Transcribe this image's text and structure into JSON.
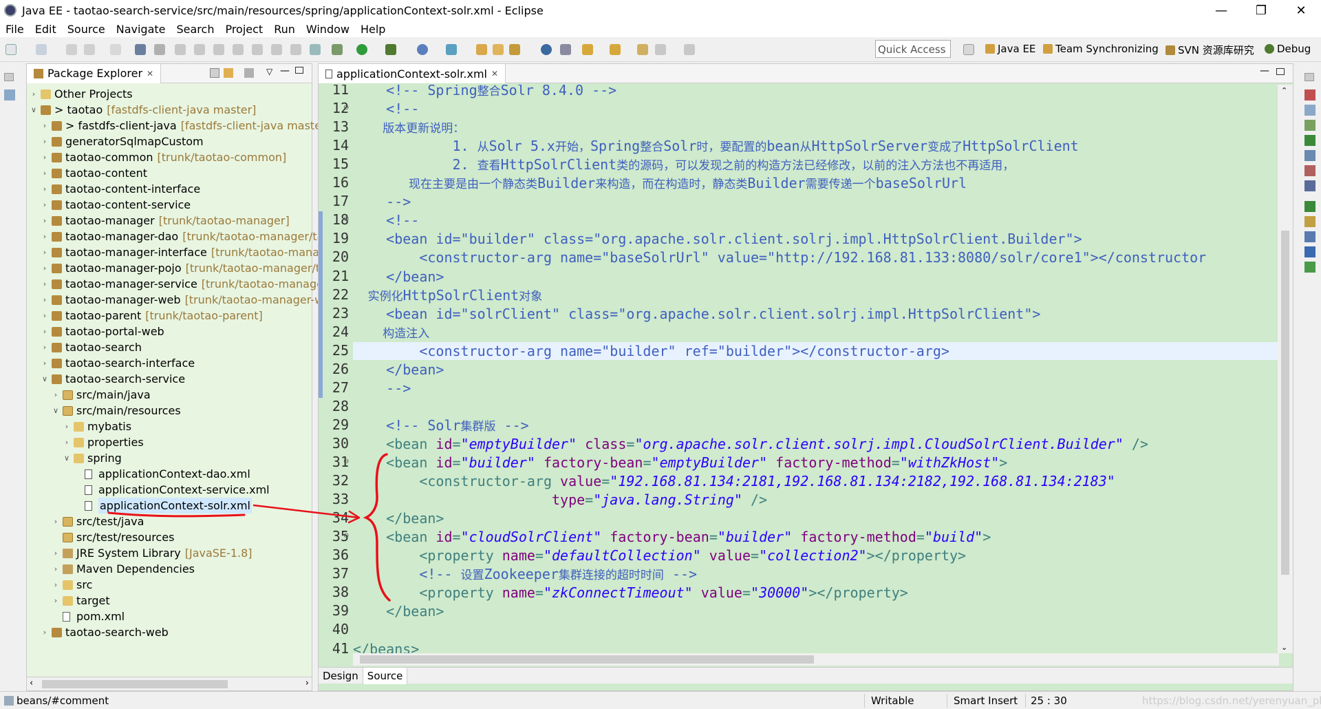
{
  "window": {
    "title": "Java EE - taotao-search-service/src/main/resources/spring/applicationContext-solr.xml - Eclipse"
  },
  "menu": [
    "File",
    "Edit",
    "Source",
    "Navigate",
    "Search",
    "Project",
    "Run",
    "Window",
    "Help"
  ],
  "toolbar": {
    "quick_access": "Quick Access",
    "perspectives": [
      "Java EE",
      "Team Synchronizing",
      "SVN 资源库研究",
      "Debug"
    ]
  },
  "package_explorer": {
    "title": "Package Explorer",
    "items": [
      {
        "label": "Other Projects",
        "decoration": "",
        "depth": 0,
        "expand": "closed",
        "icon": "folder"
      },
      {
        "label": "> taotao",
        "decoration": "[fastdfs-client-java master]",
        "depth": 0,
        "expand": "open",
        "icon": "project"
      },
      {
        "label": "> fastdfs-client-java",
        "decoration": "[fastdfs-client-java master]",
        "depth": 1,
        "expand": "closed",
        "icon": "project"
      },
      {
        "label": "generatorSqlmapCustom",
        "decoration": "",
        "depth": 1,
        "expand": "closed",
        "icon": "project"
      },
      {
        "label": "taotao-common",
        "decoration": "[trunk/taotao-common]",
        "depth": 1,
        "expand": "closed",
        "icon": "project"
      },
      {
        "label": "taotao-content",
        "decoration": "",
        "depth": 1,
        "expand": "closed",
        "icon": "project"
      },
      {
        "label": "taotao-content-interface",
        "decoration": "",
        "depth": 1,
        "expand": "closed",
        "icon": "project"
      },
      {
        "label": "taotao-content-service",
        "decoration": "",
        "depth": 1,
        "expand": "closed",
        "icon": "project"
      },
      {
        "label": "taotao-manager",
        "decoration": "[trunk/taotao-manager]",
        "depth": 1,
        "expand": "closed",
        "icon": "project"
      },
      {
        "label": "taotao-manager-dao",
        "decoration": "[trunk/taotao-manager/tao",
        "depth": 1,
        "expand": "closed",
        "icon": "project"
      },
      {
        "label": "taotao-manager-interface",
        "decoration": "[trunk/taotao-manage",
        "depth": 1,
        "expand": "closed",
        "icon": "project"
      },
      {
        "label": "taotao-manager-pojo",
        "decoration": "[trunk/taotao-manager/ta",
        "depth": 1,
        "expand": "closed",
        "icon": "project"
      },
      {
        "label": "taotao-manager-service",
        "decoration": "[trunk/taotao-manager/",
        "depth": 1,
        "expand": "closed",
        "icon": "project"
      },
      {
        "label": "taotao-manager-web",
        "decoration": "[trunk/taotao-manager-we",
        "depth": 1,
        "expand": "closed",
        "icon": "project"
      },
      {
        "label": "taotao-parent",
        "decoration": "[trunk/taotao-parent]",
        "depth": 1,
        "expand": "closed",
        "icon": "project"
      },
      {
        "label": "taotao-portal-web",
        "decoration": "",
        "depth": 1,
        "expand": "closed",
        "icon": "project"
      },
      {
        "label": "taotao-search",
        "decoration": "",
        "depth": 1,
        "expand": "closed",
        "icon": "project"
      },
      {
        "label": "taotao-search-interface",
        "decoration": "",
        "depth": 1,
        "expand": "closed",
        "icon": "project"
      },
      {
        "label": "taotao-search-service",
        "decoration": "",
        "depth": 1,
        "expand": "open",
        "icon": "project"
      },
      {
        "label": "src/main/java",
        "decoration": "",
        "depth": 2,
        "expand": "closed",
        "icon": "src"
      },
      {
        "label": "src/main/resources",
        "decoration": "",
        "depth": 2,
        "expand": "open",
        "icon": "src"
      },
      {
        "label": "mybatis",
        "decoration": "",
        "depth": 3,
        "expand": "closed",
        "icon": "folder"
      },
      {
        "label": "properties",
        "decoration": "",
        "depth": 3,
        "expand": "closed",
        "icon": "folder"
      },
      {
        "label": "spring",
        "decoration": "",
        "depth": 3,
        "expand": "open",
        "icon": "folder"
      },
      {
        "label": "applicationContext-dao.xml",
        "decoration": "",
        "depth": 4,
        "expand": "none",
        "icon": "xml"
      },
      {
        "label": "applicationContext-service.xml",
        "decoration": "",
        "depth": 4,
        "expand": "none",
        "icon": "xml"
      },
      {
        "label": "applicationContext-solr.xml",
        "decoration": "",
        "depth": 4,
        "expand": "none",
        "icon": "xml",
        "selected": true
      },
      {
        "label": "src/test/java",
        "decoration": "",
        "depth": 2,
        "expand": "closed",
        "icon": "src"
      },
      {
        "label": "src/test/resources",
        "decoration": "",
        "depth": 2,
        "expand": "none",
        "icon": "src"
      },
      {
        "label": "JRE System Library",
        "decoration": "[JavaSE-1.8]",
        "depth": 2,
        "expand": "closed",
        "icon": "lib"
      },
      {
        "label": "Maven Dependencies",
        "decoration": "",
        "depth": 2,
        "expand": "closed",
        "icon": "lib"
      },
      {
        "label": "src",
        "decoration": "",
        "depth": 2,
        "expand": "closed",
        "icon": "folder"
      },
      {
        "label": "target",
        "decoration": "",
        "depth": 2,
        "expand": "closed",
        "icon": "folder"
      },
      {
        "label": "pom.xml",
        "decoration": "",
        "depth": 2,
        "expand": "none",
        "icon": "pom"
      },
      {
        "label": "taotao-search-web",
        "decoration": "",
        "depth": 1,
        "expand": "closed",
        "icon": "project"
      }
    ]
  },
  "editor": {
    "tab": "applicationContext-solr.xml",
    "bottom_tabs": [
      "Design",
      "Source"
    ],
    "current_line": 25,
    "lines": [
      {
        "n": "11",
        "fold": "",
        "parts": [
          [
            "cm",
            "    <!-- Spring"
          ],
          [
            "cmz",
            "整合"
          ],
          [
            "cm",
            "Solr 8.4.0 -->"
          ]
        ]
      },
      {
        "n": "12",
        "fold": "⊖",
        "parts": [
          [
            "cm",
            "    <!--"
          ]
        ]
      },
      {
        "n": "13",
        "fold": "",
        "parts": [
          [
            "cmz",
            "        版本更新说明："
          ]
        ]
      },
      {
        "n": "14",
        "fold": "",
        "parts": [
          [
            "cm",
            "            1. "
          ],
          [
            "cmz",
            "从"
          ],
          [
            "cm",
            "Solr 5.x"
          ],
          [
            "cmz",
            "开始，"
          ],
          [
            "cm",
            "Spring"
          ],
          [
            "cmz",
            "整合"
          ],
          [
            "cm",
            "Solr"
          ],
          [
            "cmz",
            "时，要配置的"
          ],
          [
            "cm",
            "bean"
          ],
          [
            "cmz",
            "从"
          ],
          [
            "cm",
            "HttpSolrServer"
          ],
          [
            "cmz",
            "变成了"
          ],
          [
            "cm",
            "HttpSolrClient"
          ]
        ]
      },
      {
        "n": "15",
        "fold": "",
        "parts": [
          [
            "cm",
            "            2. "
          ],
          [
            "cmz",
            "查看"
          ],
          [
            "cm",
            "HttpSolrClient"
          ],
          [
            "cmz",
            "类的源码，可以发现之前的构造方法已经修改，以前的注入方法也不再适用，"
          ]
        ]
      },
      {
        "n": "16",
        "fold": "",
        "parts": [
          [
            "cmz",
            "               现在主要是由一个静态类"
          ],
          [
            "cm",
            "Builder"
          ],
          [
            "cmz",
            "来构造，而在构造时，静态类"
          ],
          [
            "cm",
            "Builder"
          ],
          [
            "cmz",
            "需要传递一个"
          ],
          [
            "cm",
            "baseSolrUrl"
          ]
        ]
      },
      {
        "n": "17",
        "fold": "",
        "parts": [
          [
            "cm",
            "    -->"
          ]
        ]
      },
      {
        "n": "18",
        "fold": "⊖",
        "parts": [
          [
            "cm",
            "    <!--"
          ]
        ]
      },
      {
        "n": "19",
        "fold": "",
        "parts": [
          [
            "cm",
            "    <bean id=\"builder\" class=\"org.apache.solr.client.solrj.impl.HttpSolrClient.Builder\">"
          ]
        ]
      },
      {
        "n": "20",
        "fold": "",
        "parts": [
          [
            "cm",
            "        <constructor-arg name=\"baseSolrUrl\" value=\"http://192.168.81.133:8080/solr/core1\"></constructor"
          ]
        ]
      },
      {
        "n": "21",
        "fold": "",
        "parts": [
          [
            "cm",
            "    </bean>"
          ]
        ]
      },
      {
        "n": "22",
        "fold": "",
        "parts": [
          [
            "cmz",
            "    实例化"
          ],
          [
            "cm",
            "HttpSolrClient"
          ],
          [
            "cmz",
            "对象"
          ]
        ]
      },
      {
        "n": "23",
        "fold": "",
        "parts": [
          [
            "cm",
            "    <bean id=\"solrClient\" class=\"org.apache.solr.client.solrj.impl.HttpSolrClient\">"
          ]
        ]
      },
      {
        "n": "24",
        "fold": "",
        "parts": [
          [
            "cmz",
            "        构造注入"
          ]
        ]
      },
      {
        "n": "25",
        "fold": "",
        "parts": [
          [
            "cm",
            "        <constructor-arg name=\"builder\" ref=\"builder\"></constructor-arg>"
          ]
        ]
      },
      {
        "n": "26",
        "fold": "",
        "parts": [
          [
            "cm",
            "    </bean>"
          ]
        ]
      },
      {
        "n": "27",
        "fold": "",
        "parts": [
          [
            "cm",
            "    -->"
          ]
        ]
      },
      {
        "n": "28",
        "fold": "",
        "parts": [
          [
            "cm",
            ""
          ]
        ]
      },
      {
        "n": "29",
        "fold": "",
        "parts": [
          [
            "cm",
            "    <!-- Solr"
          ],
          [
            "cmz",
            "集群版"
          ],
          [
            "cm",
            " -->"
          ]
        ]
      },
      {
        "n": "30",
        "fold": "",
        "parts": [
          [
            "kw",
            "    <bean "
          ],
          [
            "at",
            "id"
          ],
          [
            "kw",
            "="
          ],
          [
            "avi",
            "\"emptyBuilder\""
          ],
          [
            "kw",
            " "
          ],
          [
            "at",
            "class"
          ],
          [
            "kw",
            "="
          ],
          [
            "avi",
            "\"org.apache.solr.client.solrj.impl.CloudSolrClient.Builder\""
          ],
          [
            "kw",
            " />"
          ]
        ]
      },
      {
        "n": "31",
        "fold": "⊖",
        "parts": [
          [
            "kw",
            "    <bean "
          ],
          [
            "at",
            "id"
          ],
          [
            "kw",
            "="
          ],
          [
            "avi",
            "\"builder\""
          ],
          [
            "kw",
            " "
          ],
          [
            "at",
            "factory-bean"
          ],
          [
            "kw",
            "="
          ],
          [
            "avi",
            "\"emptyBuilder\""
          ],
          [
            "kw",
            " "
          ],
          [
            "at",
            "factory-method"
          ],
          [
            "kw",
            "="
          ],
          [
            "avi",
            "\"withZkHost\""
          ],
          [
            "kw",
            ">"
          ]
        ]
      },
      {
        "n": "32",
        "fold": "",
        "parts": [
          [
            "kw",
            "        <constructor-arg "
          ],
          [
            "at",
            "value"
          ],
          [
            "kw",
            "="
          ],
          [
            "avi",
            "\"192.168.81.134:2181,192.168.81.134:2182,192.168.81.134:2183\""
          ]
        ]
      },
      {
        "n": "33",
        "fold": "",
        "parts": [
          [
            "kw",
            "                        "
          ],
          [
            "at",
            "type"
          ],
          [
            "kw",
            "="
          ],
          [
            "avi",
            "\"java.lang.String\""
          ],
          [
            "kw",
            " />"
          ]
        ]
      },
      {
        "n": "34",
        "fold": "",
        "parts": [
          [
            "kw",
            "    </bean>"
          ]
        ]
      },
      {
        "n": "35",
        "fold": "⊖",
        "parts": [
          [
            "kw",
            "    <bean "
          ],
          [
            "at",
            "id"
          ],
          [
            "kw",
            "="
          ],
          [
            "avi",
            "\"cloudSolrClient\""
          ],
          [
            "kw",
            " "
          ],
          [
            "at",
            "factory-bean"
          ],
          [
            "kw",
            "="
          ],
          [
            "avi",
            "\"builder\""
          ],
          [
            "kw",
            " "
          ],
          [
            "at",
            "factory-method"
          ],
          [
            "kw",
            "="
          ],
          [
            "avi",
            "\"build\""
          ],
          [
            "kw",
            ">"
          ]
        ]
      },
      {
        "n": "36",
        "fold": "",
        "parts": [
          [
            "kw",
            "        <property "
          ],
          [
            "at",
            "name"
          ],
          [
            "kw",
            "="
          ],
          [
            "avi",
            "\"defaultCollection\""
          ],
          [
            "kw",
            " "
          ],
          [
            "at",
            "value"
          ],
          [
            "kw",
            "="
          ],
          [
            "avi",
            "\"collection2\""
          ],
          [
            "kw",
            "></property>"
          ]
        ]
      },
      {
        "n": "37",
        "fold": "",
        "parts": [
          [
            "cm",
            "        <!-- "
          ],
          [
            "cmz",
            "设置"
          ],
          [
            "cm",
            "Zookeeper"
          ],
          [
            "cmz",
            "集群连接的超时时间"
          ],
          [
            "cm",
            " -->"
          ]
        ]
      },
      {
        "n": "38",
        "fold": "",
        "parts": [
          [
            "kw",
            "        <property "
          ],
          [
            "at",
            "name"
          ],
          [
            "kw",
            "="
          ],
          [
            "avi",
            "\"zkConnectTimeout\""
          ],
          [
            "kw",
            " "
          ],
          [
            "at",
            "value"
          ],
          [
            "kw",
            "="
          ],
          [
            "avi",
            "\"30000\""
          ],
          [
            "kw",
            "></property>"
          ]
        ]
      },
      {
        "n": "39",
        "fold": "",
        "parts": [
          [
            "kw",
            "    </bean>"
          ]
        ]
      },
      {
        "n": "40",
        "fold": "",
        "parts": [
          [
            "kw",
            ""
          ]
        ]
      },
      {
        "n": "41",
        "fold": "",
        "parts": [
          [
            "kw",
            "</beans>"
          ]
        ]
      }
    ]
  },
  "status": {
    "selection_path": "beans/#comment",
    "writable": "Writable",
    "insert_mode": "Smart Insert",
    "position": "25 : 30",
    "watermark": "https://blog.csdn.net/yerenyuan_pku"
  },
  "colors": {
    "editor_bg": "#cfeacc",
    "annotation_red": "#e8101a",
    "current_line": "#e8f2fe"
  }
}
